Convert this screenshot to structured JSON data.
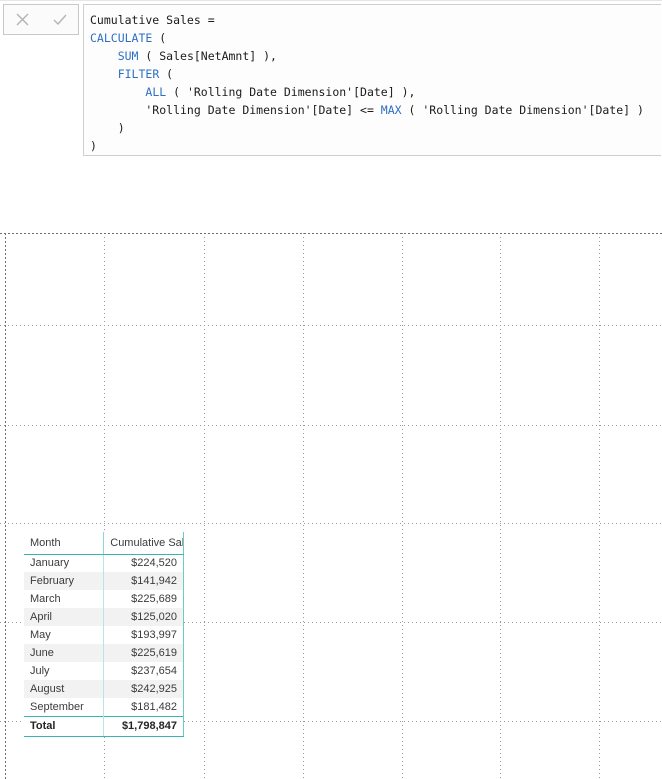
{
  "formula_bar": {
    "cancel_icon": "close-x-icon",
    "accept_icon": "checkmark-icon",
    "cancel_label": "Cancel",
    "accept_label": "Commit",
    "code_lines": [
      [
        {
          "t": "Cumulative Sales =",
          "k": false
        }
      ],
      [
        {
          "t": "CALCULATE",
          "k": true
        },
        {
          "t": " (",
          "k": false
        }
      ],
      [
        {
          "t": "    ",
          "k": false
        },
        {
          "t": "SUM",
          "k": true
        },
        {
          "t": " ( Sales[NetAmnt] ),",
          "k": false
        }
      ],
      [
        {
          "t": "    ",
          "k": false
        },
        {
          "t": "FILTER",
          "k": true
        },
        {
          "t": " (",
          "k": false
        }
      ],
      [
        {
          "t": "        ",
          "k": false
        },
        {
          "t": "ALL",
          "k": true
        },
        {
          "t": " ( 'Rolling Date Dimension'[Date] ),",
          "k": false
        }
      ],
      [
        {
          "t": "        'Rolling Date Dimension'[Date] <= ",
          "k": false
        },
        {
          "t": "MAX",
          "k": true
        },
        {
          "t": " ( 'Rolling Date Dimension'[Date] )",
          "k": false
        }
      ],
      [
        {
          "t": "    )",
          "k": false
        }
      ],
      [
        {
          "t": ")",
          "k": false
        }
      ]
    ],
    "measure_name": "Cumulative Sales",
    "keyword_color": "#2d6fc4",
    "text_color": "#1b1b1b"
  },
  "canvas": {
    "background": "#ffffff",
    "gridline_color": "#9a9a9a",
    "grid_spacing_px": 99,
    "vertical_gridlines": [
      5,
      104,
      204,
      303,
      402,
      500,
      599
    ],
    "horizontal_gridlines": [
      0,
      92,
      192,
      290,
      389,
      488
    ]
  },
  "table_visual": {
    "accent_color": "#37b5b0",
    "alt_row_color": "#f2f2f2",
    "columns": [
      {
        "key": "month",
        "label": "Month",
        "align": "left"
      },
      {
        "key": "cumulative_sales",
        "label": "Cumulative Sales",
        "align": "right"
      }
    ],
    "rows": [
      {
        "month": "January",
        "cumulative_sales": "$224,520"
      },
      {
        "month": "February",
        "cumulative_sales": "$141,942"
      },
      {
        "month": "March",
        "cumulative_sales": "$225,689"
      },
      {
        "month": "April",
        "cumulative_sales": "$125,020"
      },
      {
        "month": "May",
        "cumulative_sales": "$193,997"
      },
      {
        "month": "June",
        "cumulative_sales": "$225,619"
      },
      {
        "month": "July",
        "cumulative_sales": "$237,654"
      },
      {
        "month": "August",
        "cumulative_sales": "$242,925"
      },
      {
        "month": "September",
        "cumulative_sales": "$181,482"
      }
    ],
    "total_row": {
      "month": "Total",
      "cumulative_sales": "$1,798,847"
    }
  }
}
